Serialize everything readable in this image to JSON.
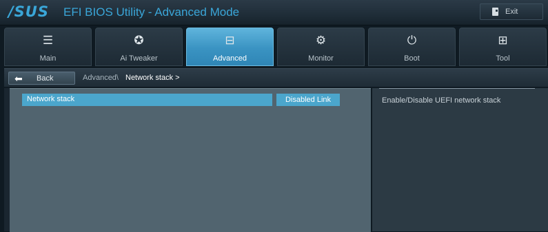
{
  "app": {
    "logo": "/SUS",
    "title": "EFI BIOS Utility - Advanced Mode",
    "exit_label": "Exit"
  },
  "tabs": [
    {
      "label": "Main",
      "icon": "list-icon",
      "glyph": "☰"
    },
    {
      "label": "Ai  Tweaker",
      "icon": "tweaker-icon",
      "glyph": "✪"
    },
    {
      "label": "Advanced",
      "icon": "advanced-icon",
      "glyph": "⊟"
    },
    {
      "label": "Monitor",
      "icon": "monitor-icon",
      "glyph": "⚙"
    },
    {
      "label": "Boot",
      "icon": "power-icon",
      "glyph": "⏻"
    },
    {
      "label": "Tool",
      "icon": "tool-icon",
      "glyph": "⊞"
    }
  ],
  "active_tab": "Advanced",
  "breadcrumb": {
    "back_label": "Back",
    "parent": "Advanced\\",
    "current": "Network stack  >"
  },
  "settings": [
    {
      "label": "Network stack",
      "value": "Disabled Link"
    }
  ],
  "help": {
    "text": "Enable/Disable UEFI network stack"
  },
  "colors": {
    "accent": "#4ba6cc",
    "panel": "#51646f",
    "logo": "#3aa6d8"
  }
}
